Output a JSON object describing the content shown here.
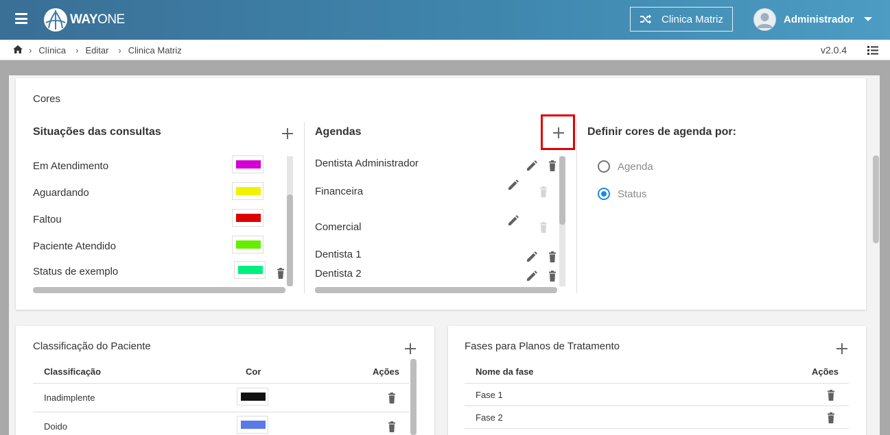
{
  "header": {
    "logo": {
      "bold": "WAY",
      "light": "ONE"
    },
    "clinic_button": "Clinica Matriz",
    "user_name": "Administrador"
  },
  "breadcrumb": {
    "items": [
      "Clínica",
      "Editar",
      "Clinica Matriz"
    ],
    "version": "v2.0.4"
  },
  "cores": {
    "title": "Cores",
    "situacoes": {
      "title": "Situações das consultas",
      "items": [
        {
          "label": "Em Atendimento",
          "color": "#d400d4"
        },
        {
          "label": "Aguardando",
          "color": "#f2f200"
        },
        {
          "label": "Faltou",
          "color": "#dd0000"
        },
        {
          "label": "Paciente Atendido",
          "color": "#66ee00"
        },
        {
          "label": "Status de exemplo",
          "color": "#00f080"
        }
      ]
    },
    "agendas": {
      "title": "Agendas",
      "items": [
        {
          "label": "Dentista Administrador",
          "delete_enabled": true
        },
        {
          "label": "Financeira",
          "delete_enabled": false
        },
        {
          "label": "Comercial",
          "delete_enabled": false
        },
        {
          "label": "Dentista 1",
          "delete_enabled": true
        },
        {
          "label": "Dentista 2",
          "delete_enabled": true
        }
      ]
    },
    "definir": {
      "title": "Definir cores de agenda por:",
      "options": [
        {
          "label": "Agenda",
          "selected": false
        },
        {
          "label": "Status",
          "selected": true
        }
      ]
    }
  },
  "classificacao": {
    "title": "Classificação do Paciente",
    "columns": [
      "Classificação",
      "Cor",
      "Ações"
    ],
    "rows": [
      {
        "label": "Inadimplente",
        "color": "#111111"
      },
      {
        "label": "Doido",
        "color": "#5a7ae8"
      }
    ]
  },
  "fases": {
    "title": "Fases para Planos de Tratamento",
    "columns": [
      "Nome da fase",
      "Ações"
    ],
    "rows": [
      {
        "label": "Fase 1"
      },
      {
        "label": "Fase 2"
      }
    ]
  },
  "icons": {
    "menu": "hamburger-icon",
    "shuffle": "shuffle-icon",
    "home": "home-icon",
    "list": "list-icon",
    "add": "plus-icon",
    "edit": "pencil-icon",
    "delete": "trash-icon"
  },
  "colors": {
    "header_start": "#3a6f96",
    "header_end": "#4c9cc3",
    "highlight": "#e00000",
    "radio_selected": "#1e88e5"
  }
}
